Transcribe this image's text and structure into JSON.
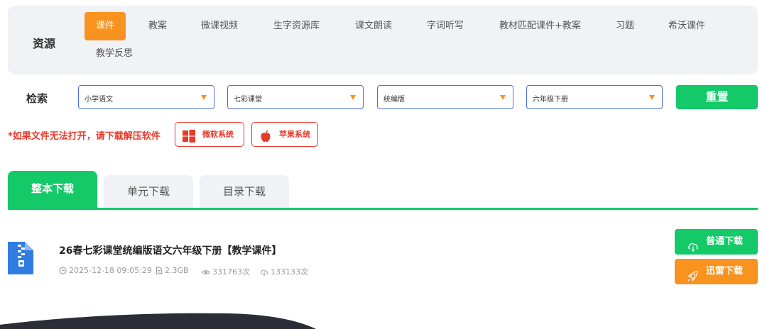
{
  "resources": {
    "label": "资源",
    "items": [
      "课件",
      "教案",
      "微课视频",
      "生字资源库",
      "课文朗读",
      "字词听写",
      "教材匹配课件+教案",
      "习题",
      "希沃课件",
      "教学反思"
    ]
  },
  "search": {
    "label": "检索",
    "selects": [
      "小学语文",
      "七彩课堂",
      "统编版",
      "六年级下册"
    ],
    "reset_label": "重置"
  },
  "notice": {
    "text": "*如果文件无法打开，请下载解压软件",
    "windows_label": "微软系统",
    "apple_label": "苹果系统"
  },
  "tabs": [
    "整本下载",
    "单元下载",
    "目录下载"
  ],
  "file": {
    "title": "26春七彩课堂统编版语文六年级下册【教学课件】",
    "date": "2025-12-18 09:05:29",
    "size": "2.3GB",
    "views": "331763次",
    "downloads": "133133次",
    "normal_download": "普通下载",
    "xunlei_download": "迅雷下载"
  },
  "colors": {
    "accent_orange": "#f7931e",
    "accent_green": "#14c968",
    "alert_red": "#e8392a",
    "select_border": "#4a6ee0"
  },
  "icons": [
    "windows-icon",
    "apple-icon",
    "zip-file-icon",
    "clock-icon",
    "file-size-icon",
    "eye-icon",
    "cloud-download-icon",
    "rocket-icon"
  ]
}
